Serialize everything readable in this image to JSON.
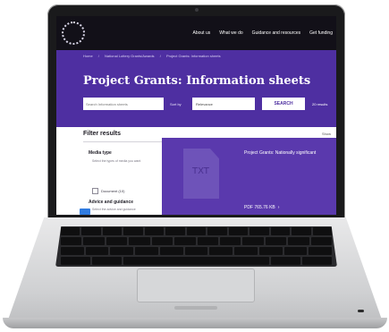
{
  "site": {
    "nav": [
      "About us",
      "What we do",
      "Guidance and resources",
      "Get funding"
    ],
    "breadcrumbs": [
      "Home",
      "/",
      "National Lottery Grants/Awards",
      "/",
      "Project Grants: Information sheets"
    ],
    "page_title": "Project Grants: Information sheets",
    "search": {
      "placeholder": "Search Information sheets",
      "sort_label": "Sort by",
      "sort_value": "Relevance",
      "button": "SEARCH",
      "per_page": "20 results"
    },
    "filter": {
      "title": "Filter results",
      "more": "Show",
      "media_type": "Media type",
      "media_note": "Select the types of media you want",
      "media_option": "Document (10)",
      "advice": "Advice and guidance",
      "advice_note": "Select the advice and guidance"
    },
    "result": {
      "thumb_label": "TXT",
      "title": "Project Grants: Nationally significant",
      "meta": "PDF 765.76 KB"
    }
  },
  "colors": {
    "accent": "#4e2fa1",
    "header": "#121018",
    "card": "#5a39ad"
  }
}
